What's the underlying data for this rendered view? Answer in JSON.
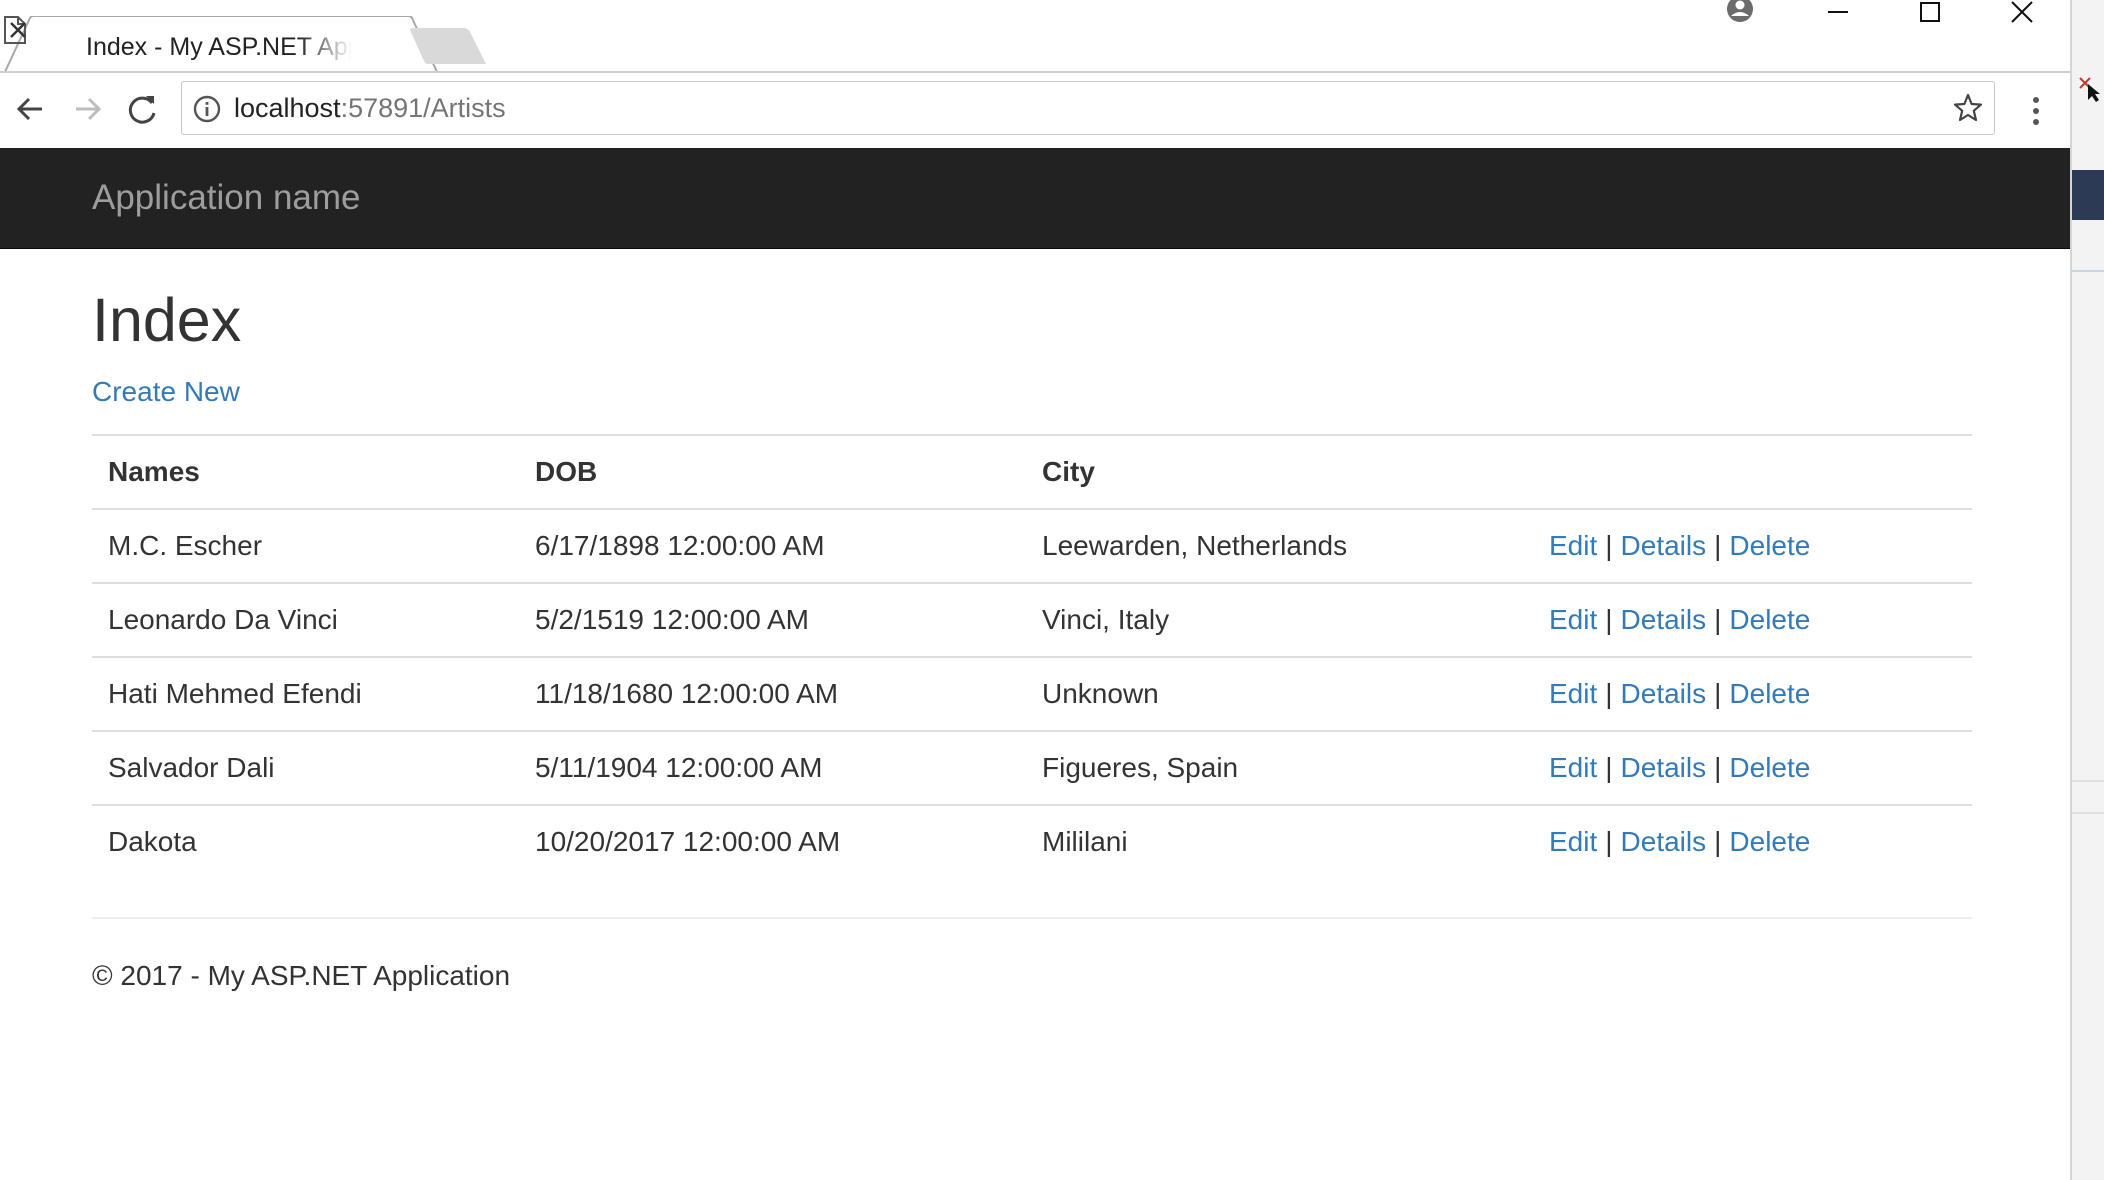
{
  "browser": {
    "tab_title": "Index - My ASP.NET Application",
    "url_host": "localhost",
    "url_rest": ":57891/Artists",
    "icons": {
      "page": "page-icon",
      "close_tab": "close-icon",
      "back": "back-arrow-icon",
      "forward": "forward-arrow-icon",
      "reload": "reload-icon",
      "info": "info-icon",
      "bookmark": "star-icon",
      "menu": "kebab-menu-icon",
      "profile": "user-icon"
    }
  },
  "navbar": {
    "brand": "Application name",
    "background": "#222222",
    "brand_color": "#9d9d9d"
  },
  "main": {
    "title": "Index",
    "create_link": "Create New",
    "link_color": "#337ab7",
    "table": {
      "headers": [
        "Names",
        "DOB",
        "City",
        ""
      ],
      "rows": [
        {
          "name": "M.C. Escher",
          "dob": "6/17/1898 12:00:00 AM",
          "city": "Leewarden, Netherlands"
        },
        {
          "name": "Leonardo Da Vinci",
          "dob": "5/2/1519 12:00:00 AM",
          "city": "Vinci, Italy"
        },
        {
          "name": "Hati Mehmed Efendi",
          "dob": "11/18/1680 12:00:00 AM",
          "city": "Unknown"
        },
        {
          "name": "Salvador Dali",
          "dob": "5/11/1904 12:00:00 AM",
          "city": "Figueres, Spain"
        },
        {
          "name": "Dakota",
          "dob": "10/20/2017 12:00:00 AM",
          "city": "Mililani"
        }
      ],
      "actions": {
        "edit": "Edit",
        "details": "Details",
        "delete": "Delete",
        "separator": "|"
      }
    }
  },
  "footer": {
    "text": "© 2017 - My ASP.NET Application"
  }
}
